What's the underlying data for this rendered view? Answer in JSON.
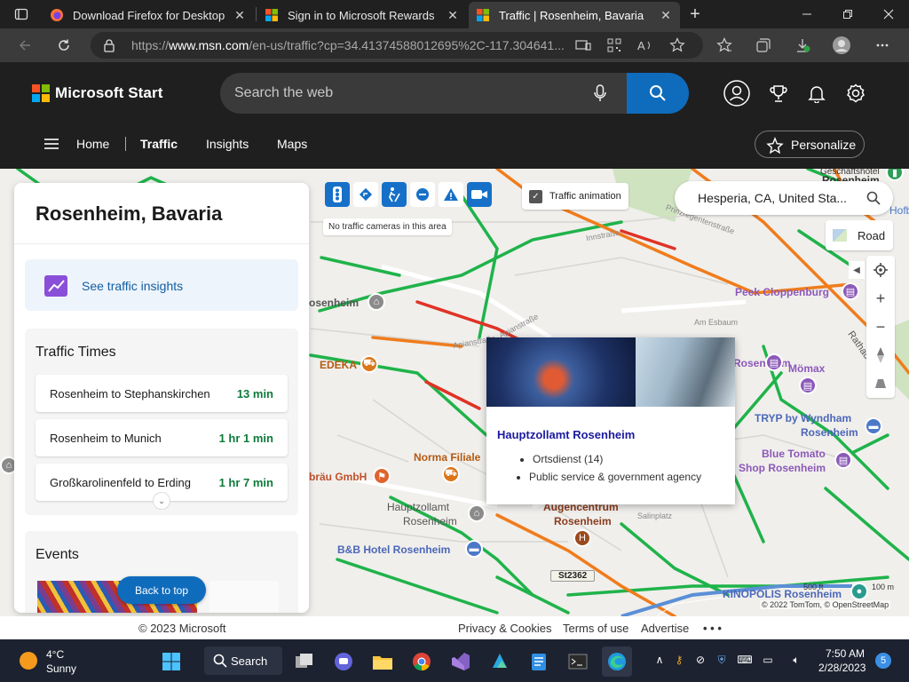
{
  "browser": {
    "tabs": [
      {
        "title": "Download Firefox for Desktop —",
        "favicon": "firefox-icon"
      },
      {
        "title": "Sign in to Microsoft Rewards",
        "favicon": "microsoft-icon"
      },
      {
        "title": "Traffic | Rosenheim, Bavaria",
        "favicon": "msn-icon",
        "active": true
      }
    ],
    "close_glyph": "✕",
    "new_tab_glyph": "+",
    "url_host": "https://www.msn.com",
    "url_prefix": "https://",
    "url_domain": "www.msn.com",
    "url_rest": "/en-us/traffic?cp=34.41374588012695%2C-117.304641..."
  },
  "header": {
    "brand": "Microsoft Start",
    "logo_colors": [
      "#f35325",
      "#81bc06",
      "#05a6f0",
      "#ffba08"
    ],
    "search_placeholder": "Search the web",
    "nav": [
      {
        "label": "Home"
      },
      {
        "label": "Traffic",
        "active": true
      },
      {
        "label": "Insights"
      },
      {
        "label": "Maps"
      }
    ],
    "personalize_label": "Personalize"
  },
  "map": {
    "traffic_animation_label": "Traffic animation",
    "traffic_animation_checked": true,
    "no_cameras_text": "No traffic cameras in this area",
    "location_value": "Hesperia, CA, United Sta...",
    "map_style_label": "Road",
    "zoom_in": "+",
    "zoom_out": "−",
    "attribution": "© 2022 TomTom,  © OpenStreetMap",
    "scale_label": "500 ft",
    "scale_label_2": "100 m",
    "labels": {
      "rosenheim_top": "Rosenheim",
      "rosenheim_left": "osenheim",
      "edeka": "EDEKA",
      "norma": "Norma Filiale",
      "braeu": "bräu GmbH",
      "hauptzollamt": "Hauptzollamt",
      "hauptzollamt_2": "Rosenheim",
      "augencentrum": "Augencentrum",
      "augencentrum_2": "Rosenheim",
      "bb_hotel": "B&B Hotel Rosenheim",
      "peek": "Peek Cloppenburg",
      "moemax": "Mömax",
      "tryp": "TRYP by Wyndham",
      "tryp_2": "Rosenheim",
      "blue_tomato": "Blue Tomato",
      "blue_tomato_2": "Shop Rosenheim",
      "kinopolis": "KINOPOLIS Rosenheim",
      "st2362": "St2362",
      "st_prinzregenten": "Prinzregentenstraße",
      "st_apian": "Apianstraße",
      "st_apian2": "Apianstraße",
      "st_salin": "Salinplatz",
      "st_mueh": "Am Esbaum",
      "st_innstr": "Innstraße",
      "st_rathaus": "Rathausstr",
      "partial_hofb": "Hofb",
      "partial_hotel_top": "Geschäftshotel"
    },
    "popup": {
      "title": "Hauptzollamt Rosenheim",
      "items": [
        "Ortsdienst (14)",
        "Public service & government agency"
      ]
    }
  },
  "panel": {
    "title": "Rosenheim, Bavaria",
    "insights_link": "See traffic insights",
    "traffic_times_heading": "Traffic Times",
    "routes": [
      {
        "name": "Rosenheim to Stephanskirchen",
        "time": "13 min"
      },
      {
        "name": "Rosenheim to Munich",
        "time": "1 hr 1 min"
      },
      {
        "name": "Großkarolinenfeld to Erding",
        "time": "1 hr 7 min"
      }
    ],
    "more_glyph": "⌄",
    "events_heading": "Events",
    "back_to_top": "Back to top"
  },
  "footer": {
    "copyright": "© 2023 Microsoft",
    "privacy": "Privacy & Cookies",
    "terms": "Terms of use",
    "advertise": "Advertise",
    "more": "• • •"
  },
  "taskbar": {
    "temperature": "4°C",
    "weather": "Sunny",
    "search_label": "Search",
    "time": "7:50 AM",
    "date": "2/28/2023",
    "notifications": "5"
  }
}
